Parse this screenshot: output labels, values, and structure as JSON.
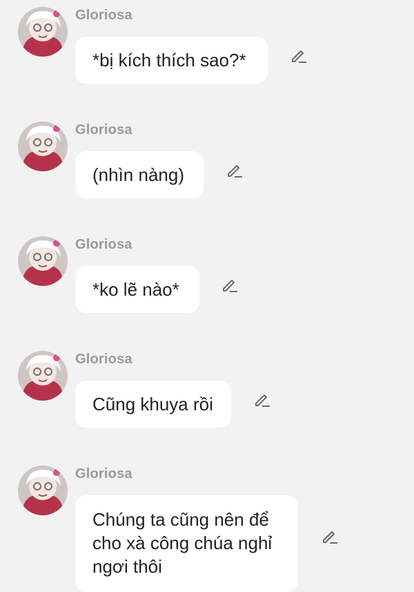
{
  "messages": [
    {
      "sender": "Gloriosa",
      "text": "*bị kích thích sao?*",
      "avatar_icon": "old-woman-avatar",
      "edit_icon": "pencil-edit-icon"
    },
    {
      "sender": "Gloriosa",
      "text": "(nhìn nàng)",
      "avatar_icon": "old-woman-avatar",
      "edit_icon": "pencil-edit-icon"
    },
    {
      "sender": "Gloriosa",
      "text": "*ko lẽ nào*",
      "avatar_icon": "old-woman-avatar",
      "edit_icon": "pencil-edit-icon"
    },
    {
      "sender": "Gloriosa",
      "text": "Cũng khuya rồi",
      "avatar_icon": "old-woman-avatar",
      "edit_icon": "pencil-edit-icon"
    },
    {
      "sender": "Gloriosa",
      "text": "Chúng ta cũng nên để cho xà công chúa nghỉ ngơi thôi",
      "avatar_icon": "old-woman-avatar",
      "edit_icon": "pencil-edit-icon"
    }
  ],
  "colors": {
    "background": "#f2f2f2",
    "bubble": "#ffffff",
    "name": "#9a9a9a",
    "text": "#222222",
    "icon": "#6b6b6b"
  }
}
